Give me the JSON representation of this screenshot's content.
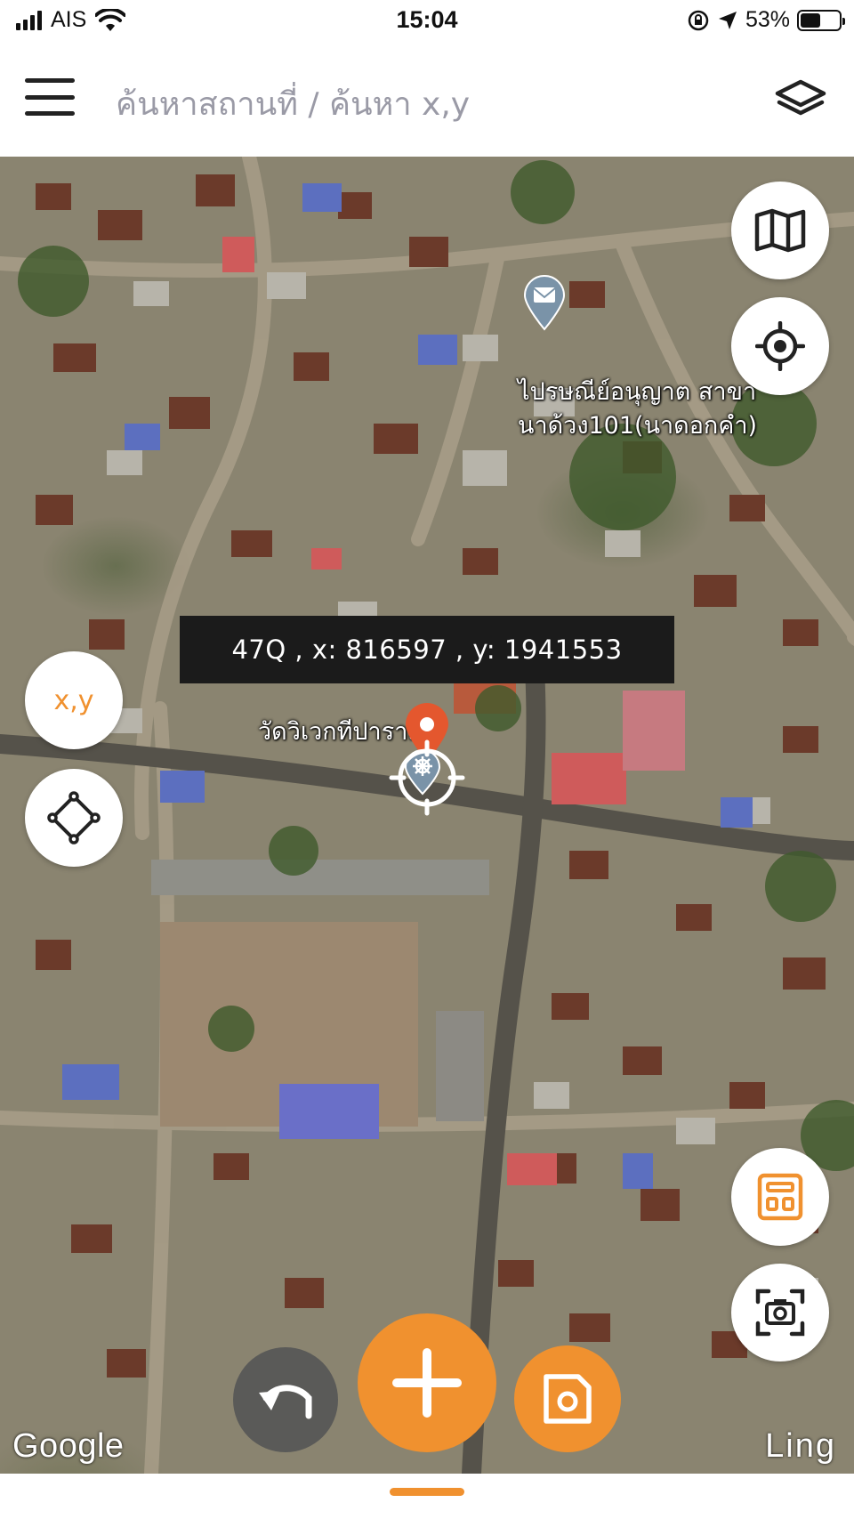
{
  "status_bar": {
    "carrier": "AIS",
    "time": "15:04",
    "battery_percent": "53%",
    "battery_level": 0.53,
    "icons": [
      "signal-icon",
      "wifi-icon",
      "orientation-lock-icon",
      "location-arrow-icon",
      "battery-icon"
    ]
  },
  "header": {
    "breadcrumb": "ค้นหาสถานที่ / ค้นหา x,y",
    "menu_icon": "hamburger-menu-icon",
    "layers_icon": "layers-icon"
  },
  "map": {
    "coordinate_readout": "47Q , x: 816597 , y: 1941553",
    "places": [
      {
        "name_line1": "ไปรษณีย์อนุญาต สาขา",
        "name_line2": "นาด้วง101(นาดอกคำ)",
        "icon": "mail-pin-icon"
      },
      {
        "name": "วัดวิเวกทีปาราม",
        "icon": "temple-pin-icon"
      }
    ],
    "attribution_left": "Google",
    "attribution_right": "Ling"
  },
  "controls": {
    "xy_button_label": "x,y",
    "right_top": [
      "map-icon",
      "my-location-icon"
    ],
    "right_bottom": [
      "calculator-icon",
      "screenshot-icon"
    ],
    "left": [
      "polygon-icon"
    ],
    "bottom": [
      "undo-icon",
      "add-icon",
      "save-icon"
    ]
  },
  "colors": {
    "accent": "#f0912f",
    "pin_red": "#e4572e",
    "dark": "#1b1b1b"
  }
}
